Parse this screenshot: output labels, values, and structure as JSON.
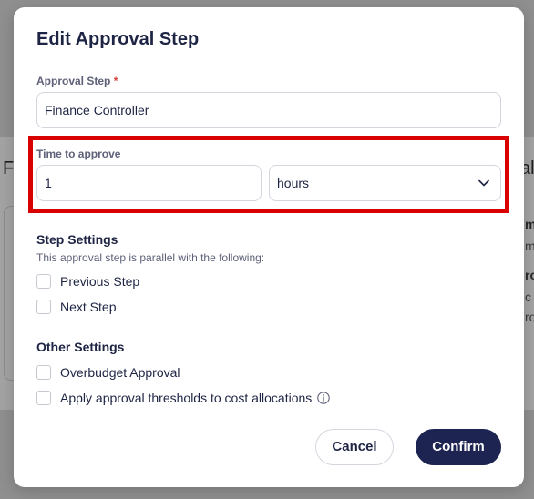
{
  "modal": {
    "title": "Edit Approval Step"
  },
  "approval_step": {
    "label": "Approval Step",
    "required_mark": "*",
    "value": "Finance Controller"
  },
  "time_to_approve": {
    "label": "Time to approve",
    "amount": "1",
    "unit": "hours"
  },
  "step_settings": {
    "title": "Step Settings",
    "description": "This approval step is parallel with the following:",
    "options": [
      {
        "label": "Previous Step",
        "checked": false
      },
      {
        "label": "Next Step",
        "checked": false
      }
    ]
  },
  "other_settings": {
    "title": "Other Settings",
    "options": [
      {
        "label": "Overbudget Approval",
        "checked": false
      },
      {
        "label": "Apply approval thresholds to cost allocations",
        "checked": false,
        "icon": "info-icon"
      }
    ]
  },
  "actions": {
    "cancel_label": "Cancel",
    "confirm_label": "Confirm"
  },
  "colors": {
    "primary": "#1e2452",
    "highlight": "#d90000",
    "required": "#d93b3b"
  },
  "background": {
    "left_fragment": "F",
    "right_fragment": "al",
    "right_rows": [
      "m",
      "m",
      "ro",
      "c",
      "ro"
    ]
  }
}
